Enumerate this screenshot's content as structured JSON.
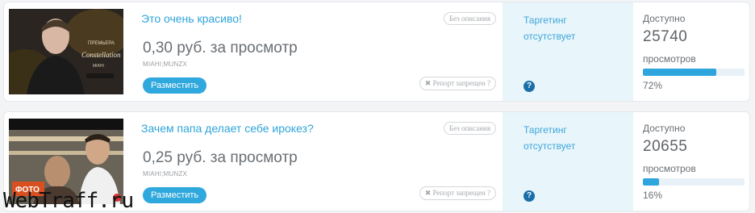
{
  "items": [
    {
      "title": "Это очень красиво!",
      "badge": "Без описания",
      "price": "0,30 руб. за просмотр",
      "author": "MIAHI;MUNZX",
      "place_button": "Разместить",
      "report_button": "✖ Репорт запрещен ?",
      "targeting": "Таргетинг отсутствует",
      "help": "?",
      "available_label": "Доступно",
      "views_count": "25740",
      "views_label": "просмотров",
      "percent_label": "72%",
      "percent": 72,
      "thumbnail_text": [
        "ПРЕМЬЕРА",
        "Constellation",
        "MIAHI"
      ]
    },
    {
      "title": "Зачем папа делает себе ирокез?",
      "badge": "Без описания",
      "price": "0,25 руб. за просмотр",
      "author": "MIAHI;MUNZX",
      "place_button": "Разместить",
      "report_button": "✖ Репорт запрещен ?",
      "targeting": "Таргетинг отсутствует",
      "help": "?",
      "available_label": "Доступно",
      "views_count": "20655",
      "views_label": "просмотров",
      "percent_label": "16%",
      "percent": 16,
      "thumbnail_text": [
        "ФОТО"
      ]
    }
  ],
  "watermark": "WebTraff.ru",
  "colors": {
    "accent": "#2fa8dd",
    "target_bg": "#e8f5fb",
    "help_icon": "#1b6fa8",
    "text_muted": "#6a6f74"
  }
}
